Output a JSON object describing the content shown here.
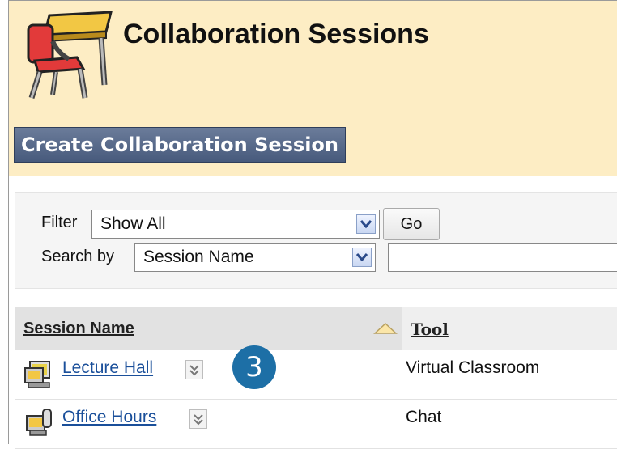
{
  "header": {
    "title": "Collaboration Sessions",
    "icon": "classroom-desk-icon",
    "background": "#fdedc4"
  },
  "actions": {
    "create_label": "Create Collaboration Session"
  },
  "filter": {
    "filter_label": "Filter",
    "filter_value": "Show All",
    "go_label": "Go",
    "search_label": "Search by",
    "search_field_value": "Session Name",
    "search_text": ""
  },
  "table": {
    "columns": [
      "Session Name",
      "Tool"
    ],
    "sort_indicator": "sort-ascending-icon",
    "rows": [
      {
        "name": "Lecture Hall",
        "tool": "Virtual Classroom",
        "icon": "virtual-classroom-icon"
      },
      {
        "name": "Office Hours",
        "tool": "Chat",
        "icon": "chat-icon"
      }
    ]
  },
  "callout": {
    "number": "3",
    "color": "#1d6fa6"
  },
  "colors": {
    "button": "#566987",
    "link": "#1a4f9a"
  }
}
